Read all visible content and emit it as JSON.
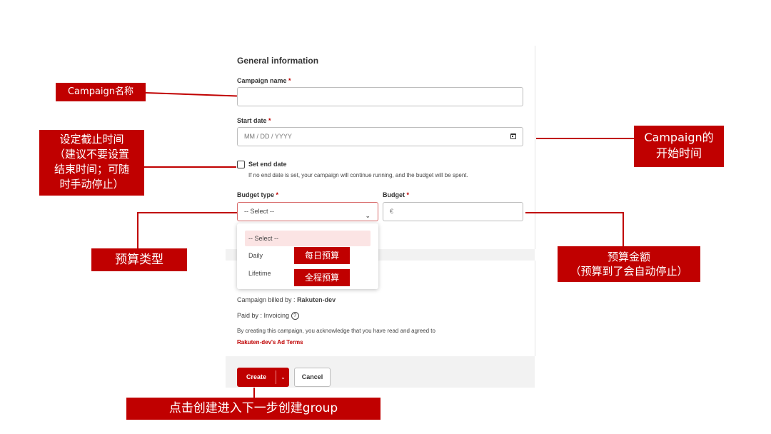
{
  "form": {
    "section_title": "General information",
    "campaign_name": {
      "label": "Campaign name",
      "required_mark": "*",
      "value": ""
    },
    "start_date": {
      "label": "Start date",
      "required_mark": "*",
      "placeholder": "MM / DD / YYYY"
    },
    "end_date": {
      "label": "Set end date",
      "checked": false,
      "help": "If no end date is set, your campaign will continue running, and the budget will be spent."
    },
    "budget_type": {
      "label": "Budget type",
      "required_mark": "*",
      "selected": "-- Select --",
      "options": [
        "-- Select --",
        "Daily",
        "Lifetime"
      ]
    },
    "budget": {
      "label": "Budget",
      "required_mark": "*",
      "currency": "€"
    }
  },
  "billing": {
    "billed_by_prefix": "Campaign billed by :",
    "billed_by": "Rakuten-dev",
    "paid_by": "Paid by : Invoicing",
    "help_icon": "help-circle-icon",
    "agreement": "By creating this campaign, you acknowledge that you have read and agreed to",
    "terms_link": "Rakuten-dev's Ad Terms"
  },
  "buttons": {
    "create": "Create",
    "create_menu_icon": "chevron-down-icon",
    "cancel": "Cancel"
  },
  "annotations": {
    "campaign_name": "Campaign名称",
    "end_date": [
      "设定截止时间",
      "（建议不要设置",
      "结束时间；可随",
      "时手动停止）"
    ],
    "start_date": [
      "Campaign的",
      "开始时间"
    ],
    "budget_type": "预算类型",
    "budget": [
      "预算金额",
      "（预算到了会自动停止）"
    ],
    "daily": "每日预算",
    "lifetime": "全程预算",
    "create": "点击创建进入下一步创建group"
  },
  "colors": {
    "accent": "#bf0000",
    "callout": "#c00000",
    "dropdown_highlight": "#fbe4e4"
  }
}
